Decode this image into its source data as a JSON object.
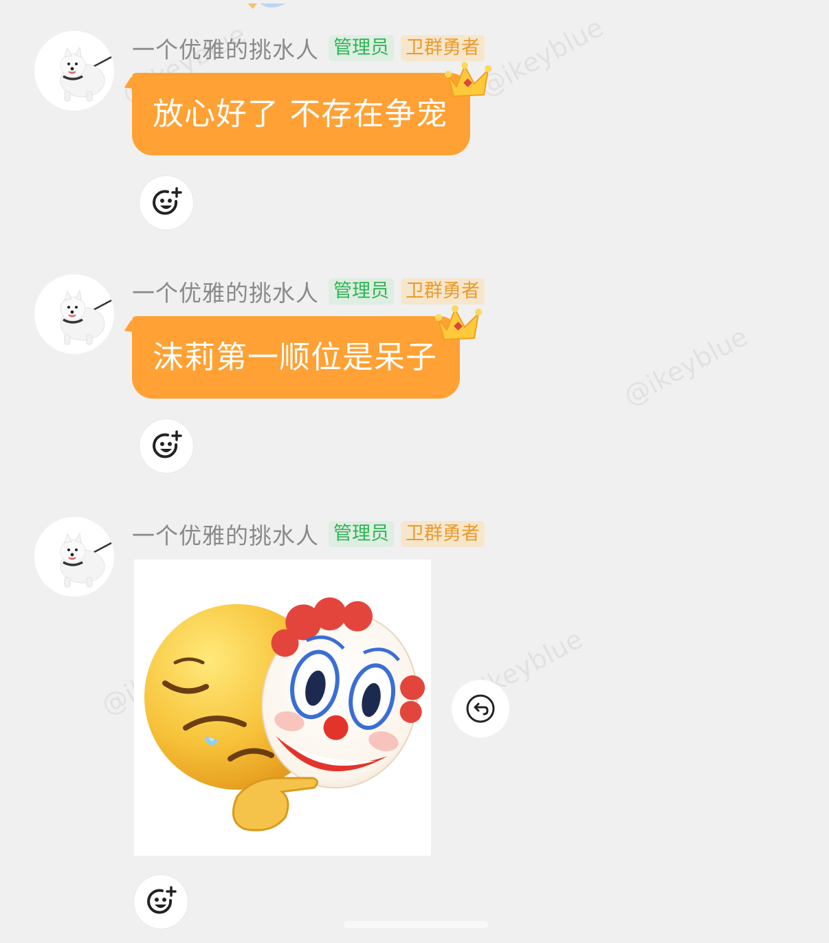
{
  "watermark": "@ikeyblue",
  "messages": [
    {
      "username": "一个优雅的挑水人",
      "badge_admin": "管理员",
      "badge_guard": "卫群勇者",
      "text": "放心好了 不存在争宠"
    },
    {
      "username": "一个优雅的挑水人",
      "badge_admin": "管理员",
      "badge_guard": "卫群勇者",
      "text": "沫莉第一顺位是呆子"
    },
    {
      "username": "一个优雅的挑水人",
      "badge_admin": "管理员",
      "badge_guard": "卫群勇者",
      "sticker": "crying-face-with-clown-mask-sticker"
    }
  ],
  "icons": {
    "avatar": "samoyed-dog-avatar",
    "add_reaction": "smiley-plus-icon",
    "reply": "reply-arrow-icon",
    "crown": "crown-icon"
  },
  "colors": {
    "bubble": "#ffa134",
    "background": "#f0f0f0",
    "admin_badge": "#2fb454",
    "guard_badge": "#eb9a2a",
    "username": "#8a8a8a"
  }
}
